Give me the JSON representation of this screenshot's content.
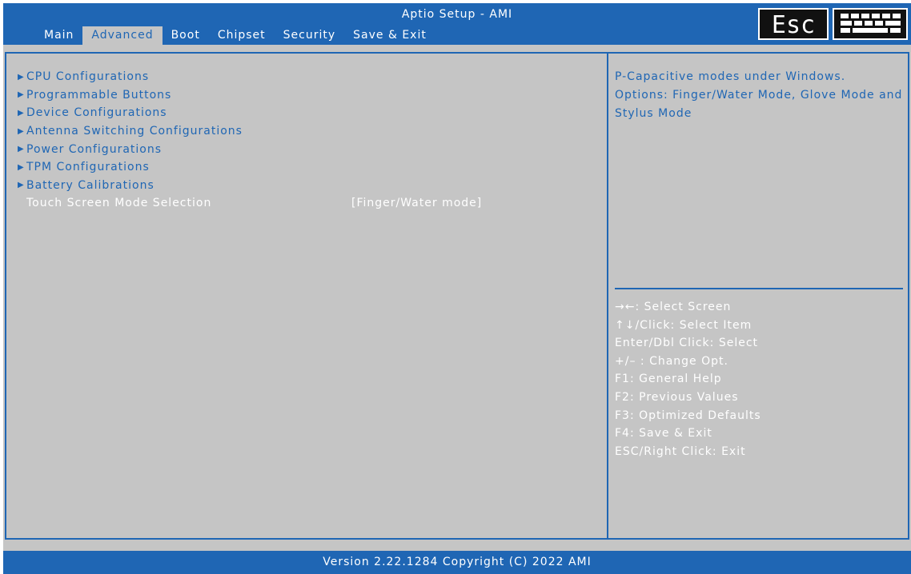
{
  "header": {
    "title": "Aptio Setup - AMI",
    "tabs": [
      {
        "label": "Main"
      },
      {
        "label": "Advanced"
      },
      {
        "label": "Boot"
      },
      {
        "label": "Chipset"
      },
      {
        "label": "Security"
      },
      {
        "label": "Save & Exit"
      }
    ],
    "active_tab": "Advanced",
    "esc_label": "Esc",
    "keyboard_icon": "keyboard-icon"
  },
  "menu": {
    "items": [
      {
        "label": "CPU Configurations",
        "icon": "submenu-arrow-icon"
      },
      {
        "label": "Programmable Buttons",
        "icon": "submenu-arrow-icon"
      },
      {
        "label": "Device Configurations",
        "icon": "submenu-arrow-icon"
      },
      {
        "label": "Antenna Switching Configurations",
        "icon": "submenu-arrow-icon"
      },
      {
        "label": "Power Configurations",
        "icon": "submenu-arrow-icon"
      },
      {
        "label": "TPM Configurations",
        "icon": "submenu-arrow-icon"
      },
      {
        "label": "Battery Calibrations",
        "icon": "submenu-arrow-icon"
      }
    ],
    "setting": {
      "label": "Touch Screen Mode Selection",
      "value": "[Finger/Water mode]"
    }
  },
  "help": {
    "text": "P-Capacitive modes under Windows. Options: Finger/Water Mode, Glove Mode and Stylus Mode",
    "keys": [
      "→←: Select Screen",
      "↑↓/Click: Select Item",
      "Enter/Dbl Click: Select",
      "+/– : Change Opt.",
      "F1: General Help",
      "F2: Previous Values",
      "F3: Optimized Defaults",
      "F4: Save & Exit",
      "ESC/Right Click: Exit"
    ]
  },
  "footer": {
    "version": "Version 2.22.1284 Copyright (C) 2022 AMI"
  },
  "colors": {
    "accent": "#1f66b4",
    "background": "#c5c5c5",
    "text_highlight": "#ffffff"
  }
}
